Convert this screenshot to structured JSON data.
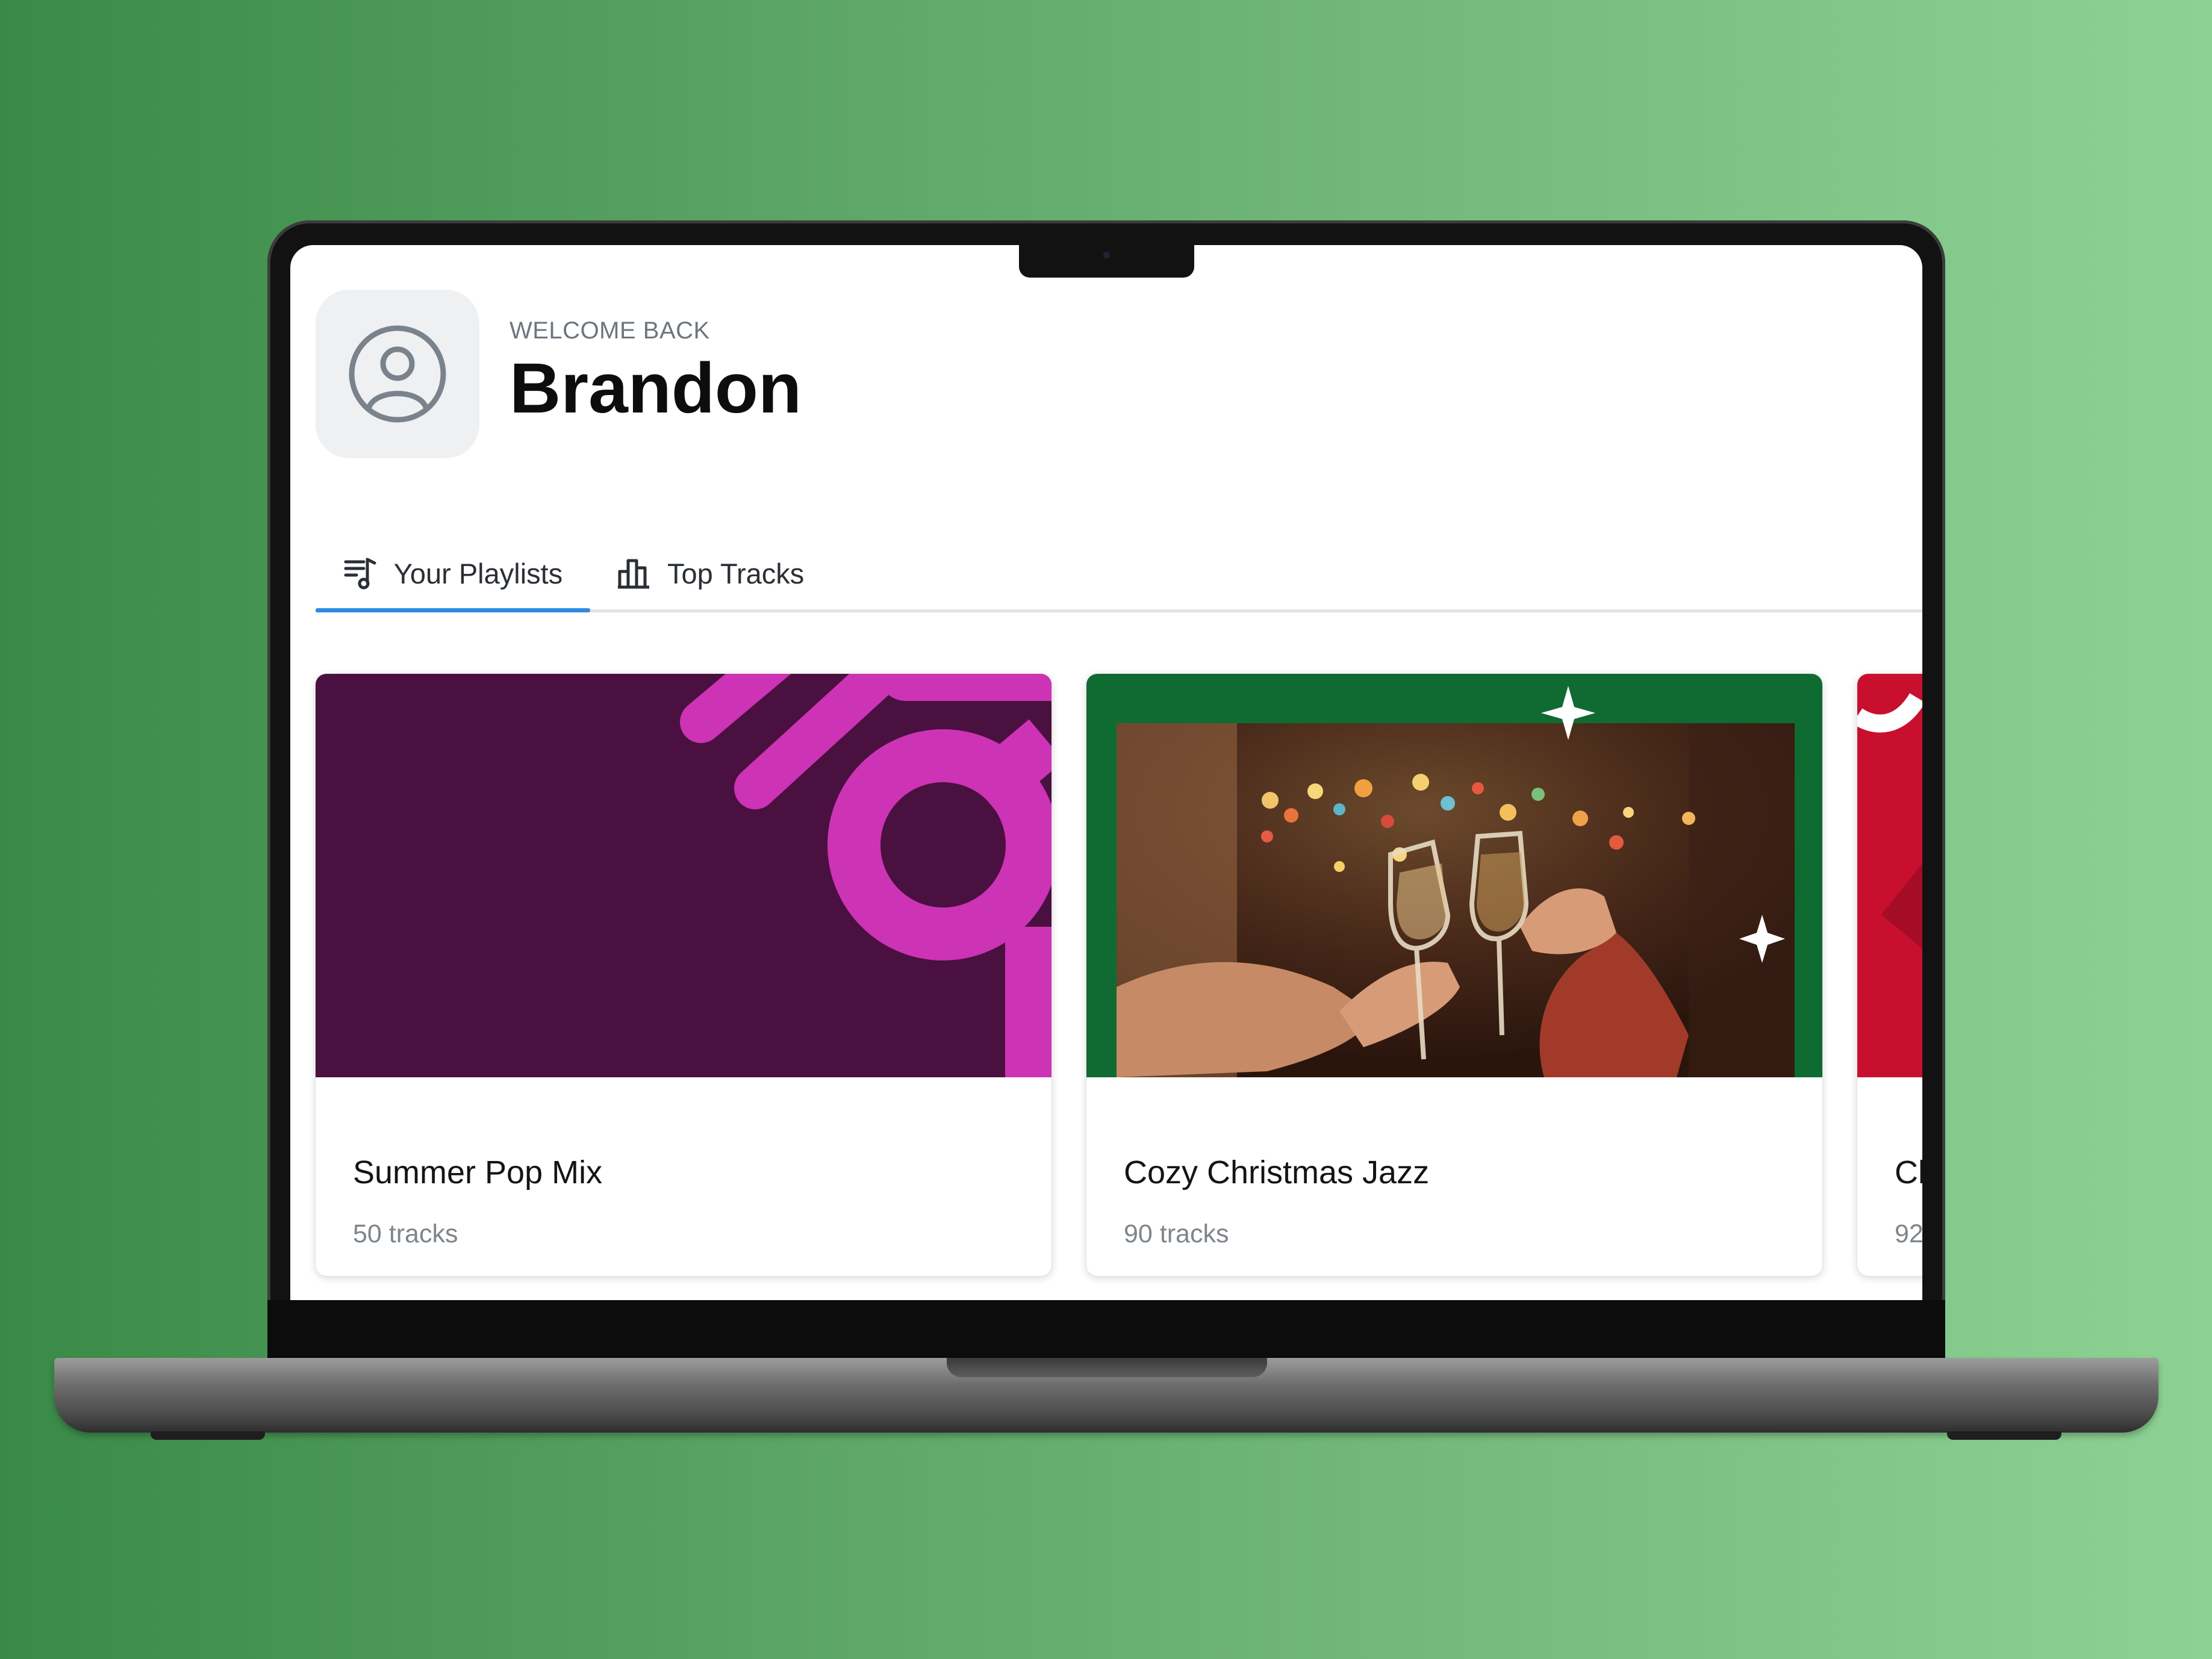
{
  "header": {
    "welcome_label": "WELCOME BACK",
    "user_name": "Brandon"
  },
  "tabs": [
    {
      "label": "Your Playlists",
      "icon": "playlist-icon",
      "active": true
    },
    {
      "label": "Top Tracks",
      "icon": "bar-chart-icon",
      "active": false
    }
  ],
  "playlists": [
    {
      "title": "Summer Pop Mix",
      "tracks": "50 tracks"
    },
    {
      "title": "Cozy Christmas Jazz",
      "tracks": "90 tracks"
    },
    {
      "title": "Cl",
      "tracks": "92"
    }
  ],
  "colors": {
    "accent": "#2f8ae0",
    "summer_cover_bg": "#4a1040",
    "summer_cover_shape": "#cc33b5",
    "christmas_cover_frame": "#0f6b31",
    "third_cover": "#c8102e"
  }
}
